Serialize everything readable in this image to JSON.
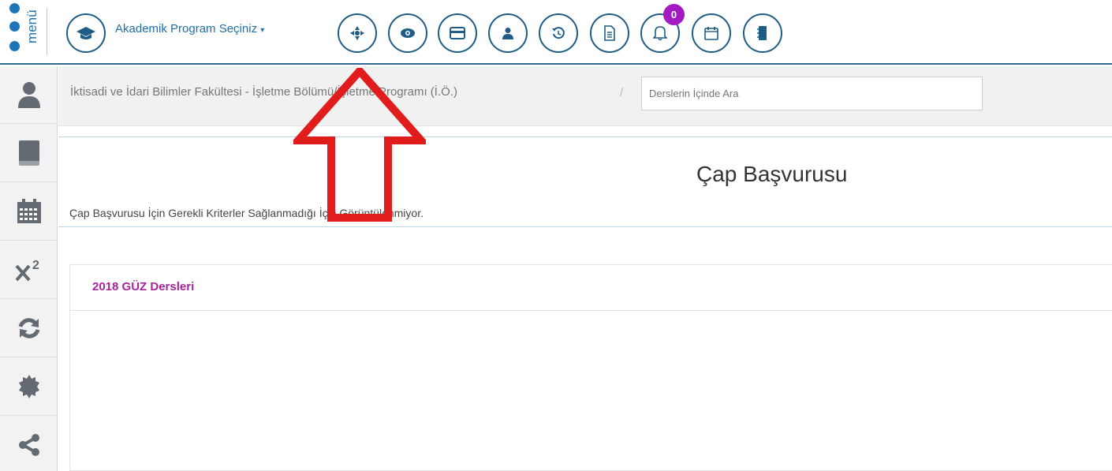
{
  "topbar": {
    "menu_label": "menü",
    "program_label": "Akademik Program Seçiniz",
    "program_caret": "▾",
    "icons": [
      "graduation-cap-icon",
      "move-icon",
      "eye-icon",
      "credit-card-icon",
      "user-icon",
      "history-icon",
      "document-icon",
      "bell-icon",
      "calendar-icon",
      "notebook-icon"
    ],
    "notification_count": "0"
  },
  "sidebar": {
    "items": [
      "user-icon",
      "book-icon",
      "calendar-icon",
      "superscript-icon",
      "refresh-icon",
      "certificate-icon",
      "share-icon"
    ]
  },
  "breadcrumb": {
    "text": "İktisadi ve İdari Bilimler Fakültesi - İşletme Bölümü/İşletme Programı (İ.Ö.)",
    "separator": "/"
  },
  "search": {
    "placeholder": "Derslerin İçinde Ara"
  },
  "main": {
    "title": "Çap Başvurusu",
    "info": "Çap Başvurusu İçin Gerekli Kriterler Sağlanmadığı İçin Görüntülenmiyor."
  },
  "panel": {
    "title": "2018 GÜZ Dersleri"
  },
  "colors": {
    "accent": "#1e74b6",
    "border": "#1f5d86",
    "badge": "#a31ac2",
    "panel_title": "#a8249a",
    "arrow": "#e01c1c"
  }
}
